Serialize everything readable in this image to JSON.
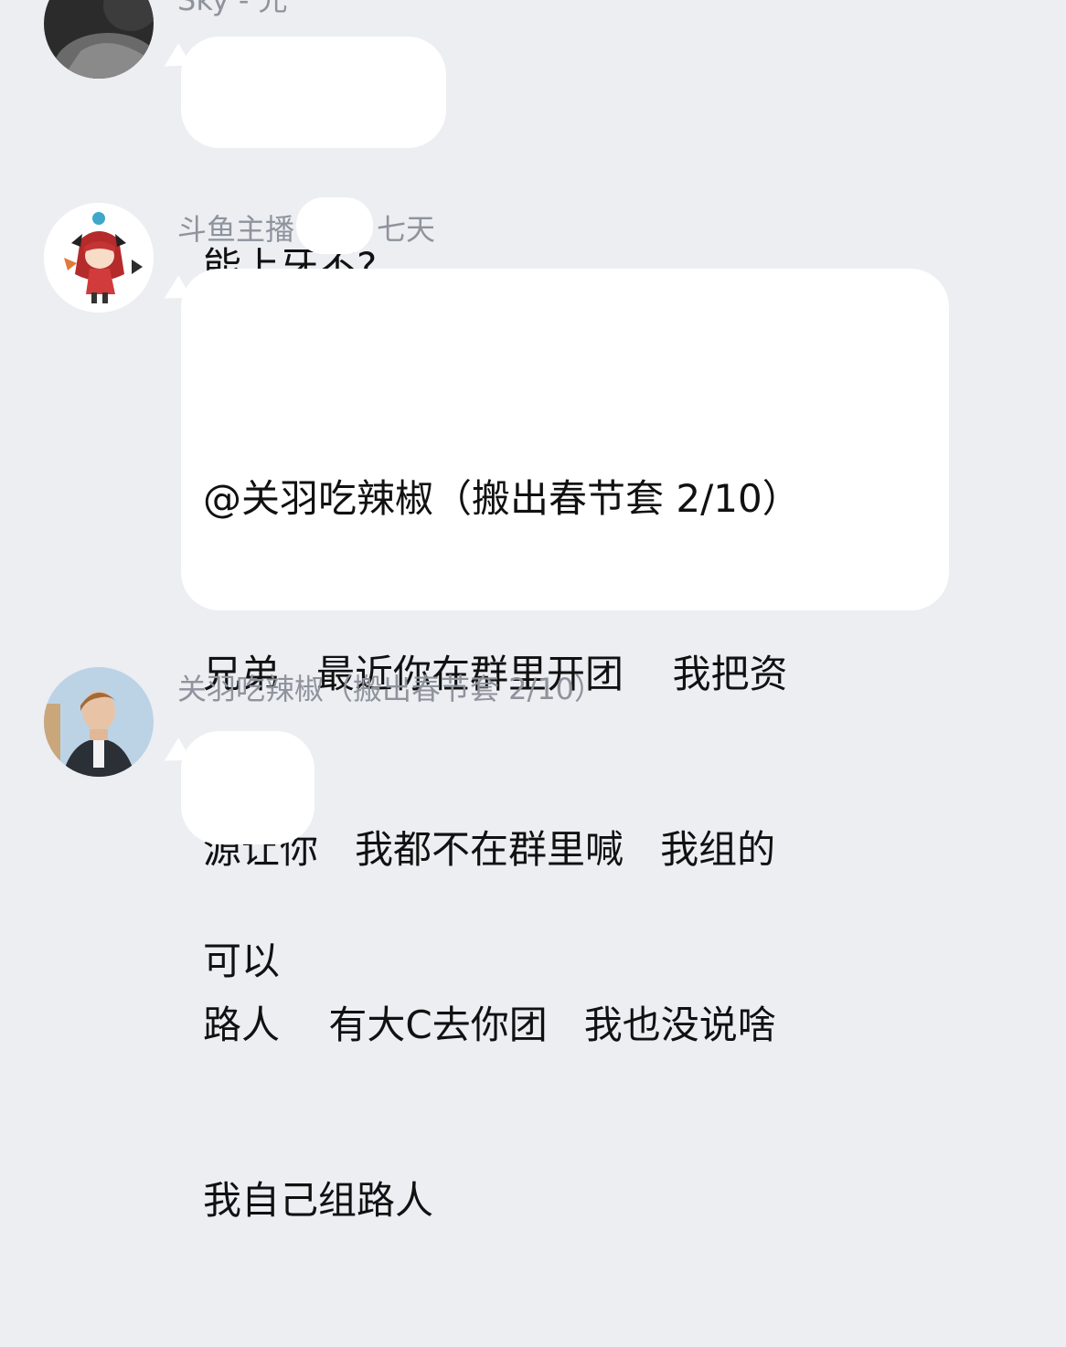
{
  "messages": [
    {
      "sender": "Sky - 兄",
      "avatar_icon": "user-avatar-photo-dark",
      "text_lines": [
        "能上牙不?"
      ]
    },
    {
      "sender_prefix": "斗鱼主播",
      "sender_suffix": "七天",
      "avatar_icon": "anime-girl-avatar",
      "text_lines": [
        "@关羽吃辣椒（搬出春节套 2/10）",
        "兄弟   最近你在群里开团    我把资",
        "源让你   我都不在群里喊   我组的",
        "路人    有大C去你团   我也没说啥",
        "我自己组路人"
      ]
    },
    {
      "sender": "关羽吃辣椒（搬出春节套 2/10）",
      "avatar_icon": "user-avatar-photo-boy",
      "text_lines": [
        "可以"
      ]
    }
  ]
}
